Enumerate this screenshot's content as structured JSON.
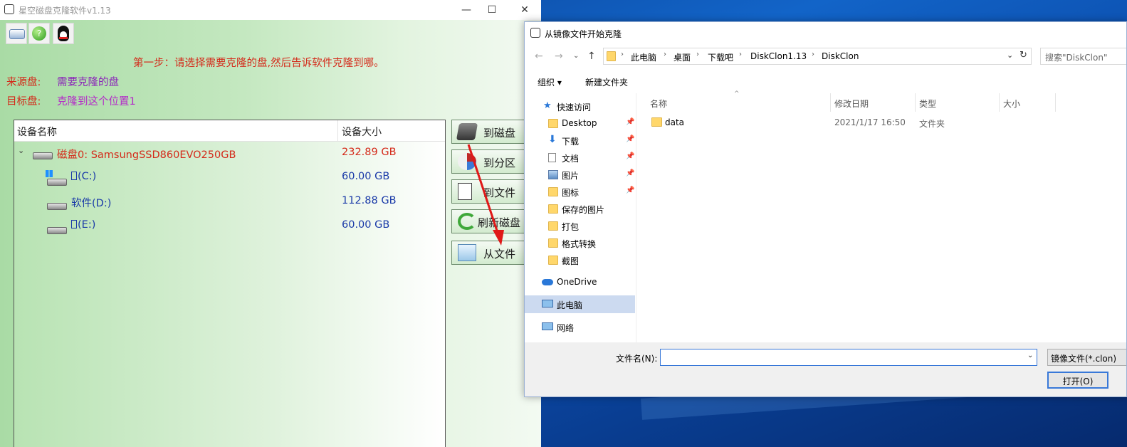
{
  "app": {
    "title": "星空磁盘克隆软件v1.13",
    "step_text": "第一步：请选择需要克隆的盘,然后告诉软件克隆到哪。",
    "source_label": "来源盘:",
    "source_value": "需要克隆的盘",
    "target_label": "目标盘:",
    "target_value": "克隆到这个位置1",
    "columns": [
      "设备名称",
      "设备大小"
    ],
    "rows": [
      {
        "name": "磁盘0: SamsungSSD860EVO250GB",
        "size": "232.89 GB"
      },
      {
        "name": "(C:)",
        "size": "60.00 GB"
      },
      {
        "name": "软件(D:)",
        "size": "112.88 GB"
      },
      {
        "name": "(E:)",
        "size": "60.00 GB"
      }
    ],
    "side_buttons": [
      "到磁盘",
      "到分区",
      "到文件",
      "刷新磁盘",
      "从文件"
    ],
    "window_controls": [
      "—",
      "☐",
      "✕"
    ],
    "colors": {
      "red": "#d42a1a",
      "purple": "#8a24b8",
      "magenta": "#b428c8",
      "blue_text": "#1a3aa8"
    }
  },
  "dialog": {
    "title": "从镜像文件开始克隆",
    "breadcrumb": [
      "此电脑",
      "桌面",
      "下载吧",
      "DiskClon1.13",
      "DiskClon"
    ],
    "search_placeholder": "搜索\"DiskClon\"",
    "commands": {
      "organize": "组织 ▾",
      "new_folder": "新建文件夹"
    },
    "nav": [
      {
        "label": "快速访问",
        "icon": "star-icon",
        "pinned": false
      },
      {
        "label": "Desktop",
        "icon": "folder-icon",
        "pinned": true
      },
      {
        "label": "下载",
        "icon": "download-icon",
        "pinned": true
      },
      {
        "label": "文档",
        "icon": "document-icon",
        "pinned": true
      },
      {
        "label": "图片",
        "icon": "picture-icon",
        "pinned": true
      },
      {
        "label": "图标",
        "icon": "folder-icon",
        "pinned": true
      },
      {
        "label": "保存的图片",
        "icon": "folder-icon",
        "pinned": false
      },
      {
        "label": "打包",
        "icon": "folder-icon",
        "pinned": false
      },
      {
        "label": "格式转换",
        "icon": "folder-icon",
        "pinned": false
      },
      {
        "label": "截图",
        "icon": "folder-icon",
        "pinned": false
      },
      {
        "label": "OneDrive",
        "icon": "cloud-icon",
        "pinned": false
      },
      {
        "label": "此电脑",
        "icon": "computer-icon",
        "pinned": false
      },
      {
        "label": "网络",
        "icon": "network-icon",
        "pinned": false
      }
    ],
    "list_columns": [
      "名称",
      "修改日期",
      "类型",
      "大小"
    ],
    "files": [
      {
        "name": "data",
        "date": "2021/1/17 16:50",
        "type": "文件夹",
        "size": ""
      }
    ],
    "filename_label": "文件名(N):",
    "filename_value": "",
    "filetype": "镜像文件(*.clon)",
    "open_button": "打开(O)"
  }
}
